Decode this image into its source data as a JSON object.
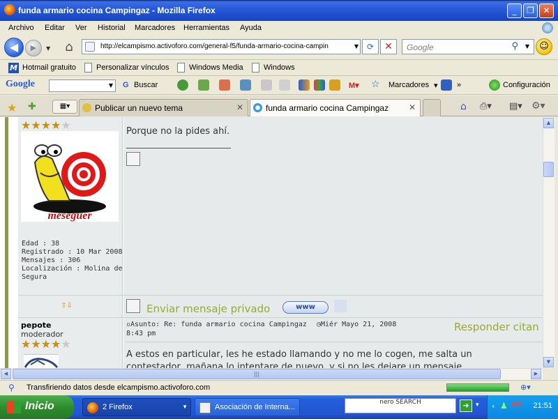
{
  "window": {
    "title": "funda armario cocina Campingaz - Mozilla Firefox"
  },
  "menu": [
    "Archivo",
    "Editar",
    "Ver",
    "Historial",
    "Marcadores",
    "Herramientas",
    "Ayuda"
  ],
  "nav": {
    "url": "http://elcampismo.activoforo.com/general-f5/funda-armario-cocina-campin",
    "search_placeholder": "Google"
  },
  "bookmarks": [
    "Hotmail gratuito",
    "Personalizar vínculos",
    "Windows Media",
    "Windows"
  ],
  "google_toolbar": {
    "logo": "Google",
    "search_label": "Buscar",
    "bookmarks_label": "Marcadores",
    "more": "»",
    "settings_label": "Configuración"
  },
  "tabs": [
    {
      "label": "Publicar un nuevo tema",
      "active": false
    },
    {
      "label": "funda armario cocina Campingaz",
      "active": true
    }
  ],
  "post1": {
    "rating_stars": 4,
    "avatar_caption": "meseguer",
    "profile": {
      "edad": "Edad : 38",
      "registrado": "Registrado : 10 Mar 2008",
      "mensajes": "Mensajes : 306",
      "localizacion_1": "Localización : Molina de",
      "localizacion_2": "Segura"
    },
    "message": "Porque no la pides ahí.",
    "pm_link": "Enviar mensaje privado",
    "www_label": "www"
  },
  "post2": {
    "username": "pepote",
    "rank": "moderador",
    "rating_stars": 4,
    "subject": "Asunto: Re: funda armario cocina Campingaz",
    "date_1": "Miér Mayo 21, 2008",
    "date_2": "8:43 pm",
    "reply_label": "Responder citan",
    "message_line1": "A estos en particular, les he estado llamando y no me lo cogen, me salta un",
    "message_line2": "contestador, mañana lo intentare de nuevo, y si no les dejare un mensaje."
  },
  "status": {
    "text": "Transfiriendo datos desde elcampismo.activoforo.com",
    "progress": 1.0
  },
  "taskbar": {
    "start": "Inicio",
    "tasks": [
      "2 Firefox",
      "Asociación de Interna..."
    ],
    "nero": "nero SEARCH",
    "clock": "21:51"
  },
  "colors": {
    "accent_green": "#9aaa30",
    "star_gold": "#c89010",
    "title_blue": "#2a5bd7"
  }
}
